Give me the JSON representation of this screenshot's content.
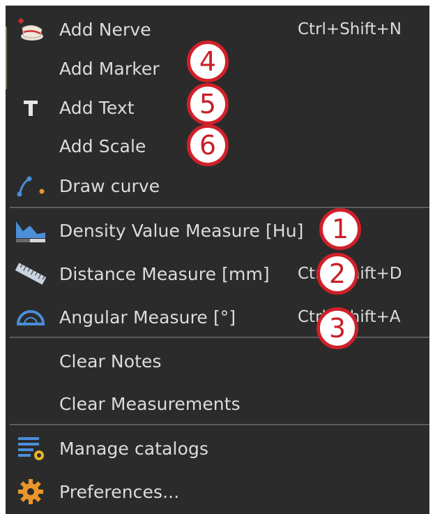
{
  "menu": {
    "items": [
      {
        "label": "Add Nerve",
        "shortcut": "Ctrl+Shift+N",
        "icon": "nerve-icon"
      },
      {
        "label": "Add Marker",
        "shortcut": "",
        "icon": ""
      },
      {
        "label": "Add Text",
        "shortcut": "",
        "icon": "text-icon"
      },
      {
        "label": "Add Scale",
        "shortcut": "",
        "icon": ""
      },
      {
        "label": "Draw curve",
        "shortcut": "",
        "icon": "curve-icon"
      },
      {
        "label": "Density Value Measure [Hu]",
        "shortcut": "",
        "icon": "density-icon"
      },
      {
        "label": "Distance Measure [mm]",
        "shortcut": "Ctrl+Shift+D",
        "icon": "ruler-icon"
      },
      {
        "label": "Angular Measure [°]",
        "shortcut": "Ctrl+Shift+A",
        "icon": "protractor-icon"
      },
      {
        "label": "Clear Notes",
        "shortcut": "",
        "icon": ""
      },
      {
        "label": "Clear Measurements",
        "shortcut": "",
        "icon": ""
      },
      {
        "label": "Manage catalogs",
        "shortcut": "",
        "icon": "catalog-icon"
      },
      {
        "label": "Preferences...",
        "shortcut": "",
        "icon": "gear-icon"
      }
    ]
  },
  "annotations": {
    "badge_1": "1",
    "badge_2": "2",
    "badge_3": "3",
    "badge_4": "4",
    "badge_5": "5",
    "badge_6": "6"
  },
  "colors": {
    "menu_bg": "#2b2b2b",
    "text": "#dcdcdc",
    "separator": "#5c5c5c",
    "badge_border": "#d0202a",
    "icon_blue": "#4a8fd8",
    "icon_orange": "#e8962a"
  }
}
